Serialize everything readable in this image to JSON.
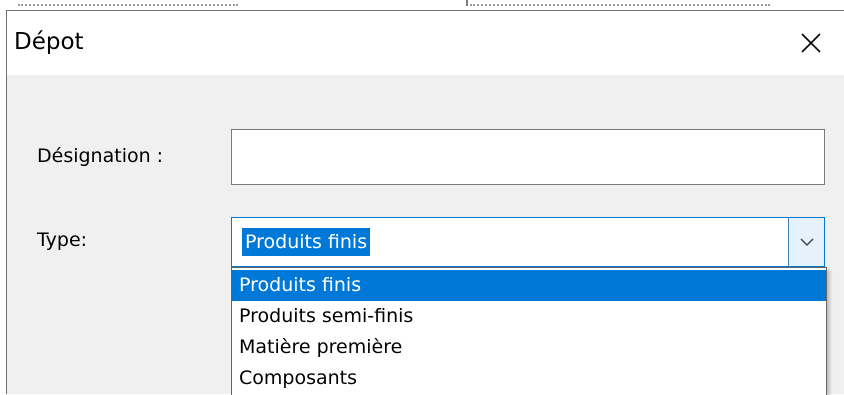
{
  "dialog": {
    "title": "Dépot",
    "close_icon": "close-icon"
  },
  "form": {
    "designation_label": "Désignation :",
    "designation_value": "",
    "type_label": "Type:",
    "type_selected": "Produits finis"
  },
  "dropdown": {
    "options": [
      "Produits finis",
      "Produits semi-finis",
      "Matière première",
      "Composants"
    ],
    "selected_index": 0
  },
  "colors": {
    "accent": "#0078d7",
    "dialog_bg": "#f0f0f0",
    "titlebar_bg": "#ffffff"
  }
}
